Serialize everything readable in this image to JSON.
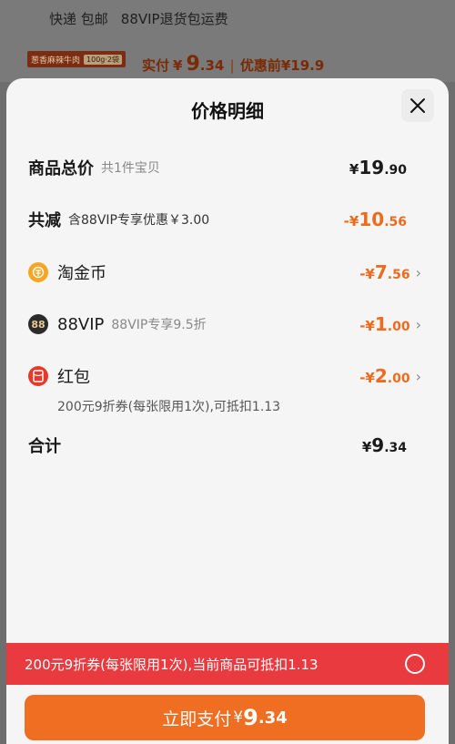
{
  "background": {
    "shipping_label": "快递 包邮",
    "return_label": "88VIP退货包运费",
    "product_thumb_text": "葱香麻辣牛肉",
    "product_thumb_chip": "100g·2袋",
    "actual_label": "实付",
    "actual_currency": "¥",
    "actual_int": "9",
    "actual_dec": ".34",
    "separator": "|",
    "original_price": "优惠前¥19.9"
  },
  "sheet": {
    "title": "价格明细",
    "close_icon": "close-icon"
  },
  "total": {
    "label": "商品总价",
    "sub": "共1件宝贝",
    "currency": "¥",
    "int": "19",
    "dec": ".90"
  },
  "reduction": {
    "label": "共减",
    "sub": "含88VIP专享优惠￥3.00",
    "currency": "-¥",
    "int": "10",
    "dec": ".56"
  },
  "items": [
    {
      "icon": "coin-icon",
      "label": "淘金币",
      "sub": "",
      "currency": "-¥",
      "int": "7",
      "dec": ".56"
    },
    {
      "icon": "vip-icon",
      "icon_text": "88",
      "label": "88VIP",
      "sub": "88VIP专享9.5折",
      "currency": "-¥",
      "int": "1",
      "dec": ".00"
    },
    {
      "icon": "redpacket-icon",
      "label": "红包",
      "sub": "",
      "currency": "-¥",
      "int": "2",
      "dec": ".00",
      "note": "200元9折券(每张限用1次),可抵扣1.13"
    }
  ],
  "subtotal": {
    "label": "合计",
    "currency": "¥",
    "int": "9",
    "dec": ".34"
  },
  "coupon_bar": {
    "text": "200元9折券(每张限用1次),当前商品可抵扣1.13",
    "checked": false
  },
  "pay_button": {
    "label": "立即支付",
    "currency": "¥",
    "int": "9",
    "dec": ".34"
  },
  "colors": {
    "accent_orange": "#f06e21",
    "discount_orange": "#ee6a1d",
    "coupon_red": "#e83a3f"
  }
}
